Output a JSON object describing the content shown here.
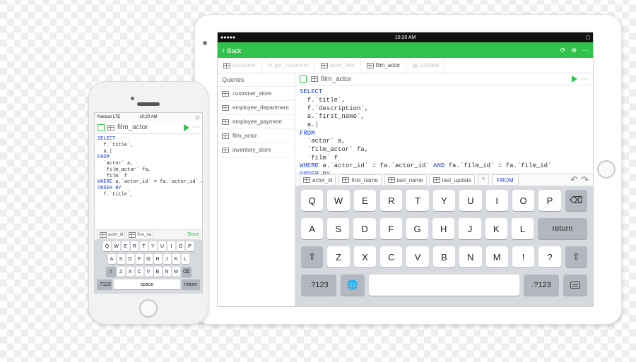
{
  "phone": {
    "status": {
      "carrier": "Navicat LTE",
      "time": "10:20 AM"
    },
    "table_name": "film_actor",
    "sql": "SELECT\n  f.`title`,\n  a.|\nFROM\n  `actor` a,\n  `film_actor` fa,\n  `film` f\nWHERE a.`actor_id` = fa.`actor_id` AND fa.`film_id` = fa.`film_id`\nORDER BY\n  f.`title`,",
    "suggestions": [
      "actor_id",
      "first_na"
    ],
    "done": "Done",
    "keyboard": {
      "row1": [
        "Q",
        "W",
        "E",
        "R",
        "T",
        "Y",
        "U",
        "I",
        "O",
        "P"
      ],
      "row2": [
        "A",
        "S",
        "D",
        "F",
        "G",
        "H",
        "J",
        "K",
        "L"
      ],
      "row3": [
        "Z",
        "X",
        "C",
        "V",
        "B",
        "N",
        "M"
      ],
      "row4_mode": ".?123",
      "row4_space": "space",
      "row4_return": "return"
    }
  },
  "tablet": {
    "status": {
      "time": "10:20 AM"
    },
    "nav": {
      "back": "Back"
    },
    "tabs": [
      {
        "label": "customer",
        "icon": "table-icon",
        "state": "dim"
      },
      {
        "label": "get_customer",
        "icon": "fx-icon",
        "state": "dim"
      },
      {
        "label": "actor_info",
        "icon": "view-icon",
        "state": "dim"
      },
      {
        "label": "film_actor",
        "icon": "table-icon",
        "state": "active"
      },
      {
        "label": "Untitled",
        "icon": "doc-icon",
        "state": "dim"
      }
    ],
    "sidebar": {
      "heading": "Queries",
      "items": [
        "customer_store",
        "employee_department",
        "employee_payment",
        "film_actor",
        "inventory_store"
      ]
    },
    "content": {
      "table_name": "film_actor",
      "sql": "SELECT\n  f.`title`,\n  f.`description`,\n  a.`first_name`,\n  a.|\nFROM\n  `actor` a,\n  `film_actor` fa,\n  `film` f\nWHERE a.`actor_id` = fa.`actor_id` AND fa.`film_id` = fa.`film_id`\nORDER BY\n  f.`title`,\n  a.`last name`.",
      "suggestions": [
        "actor_id",
        "first_name",
        "last_name",
        "last_update"
      ],
      "kw_suggestion": "FROM"
    },
    "keyboard": {
      "row1": [
        "Q",
        "W",
        "E",
        "R",
        "T",
        "Y",
        "U",
        "I",
        "O",
        "P"
      ],
      "row2": [
        "A",
        "S",
        "D",
        "F",
        "G",
        "H",
        "J",
        "K",
        "L"
      ],
      "row3": [
        "Z",
        "X",
        "C",
        "V",
        "B",
        "N",
        "M",
        "!",
        "?"
      ],
      "return": "return",
      "mode": ".?123"
    }
  }
}
